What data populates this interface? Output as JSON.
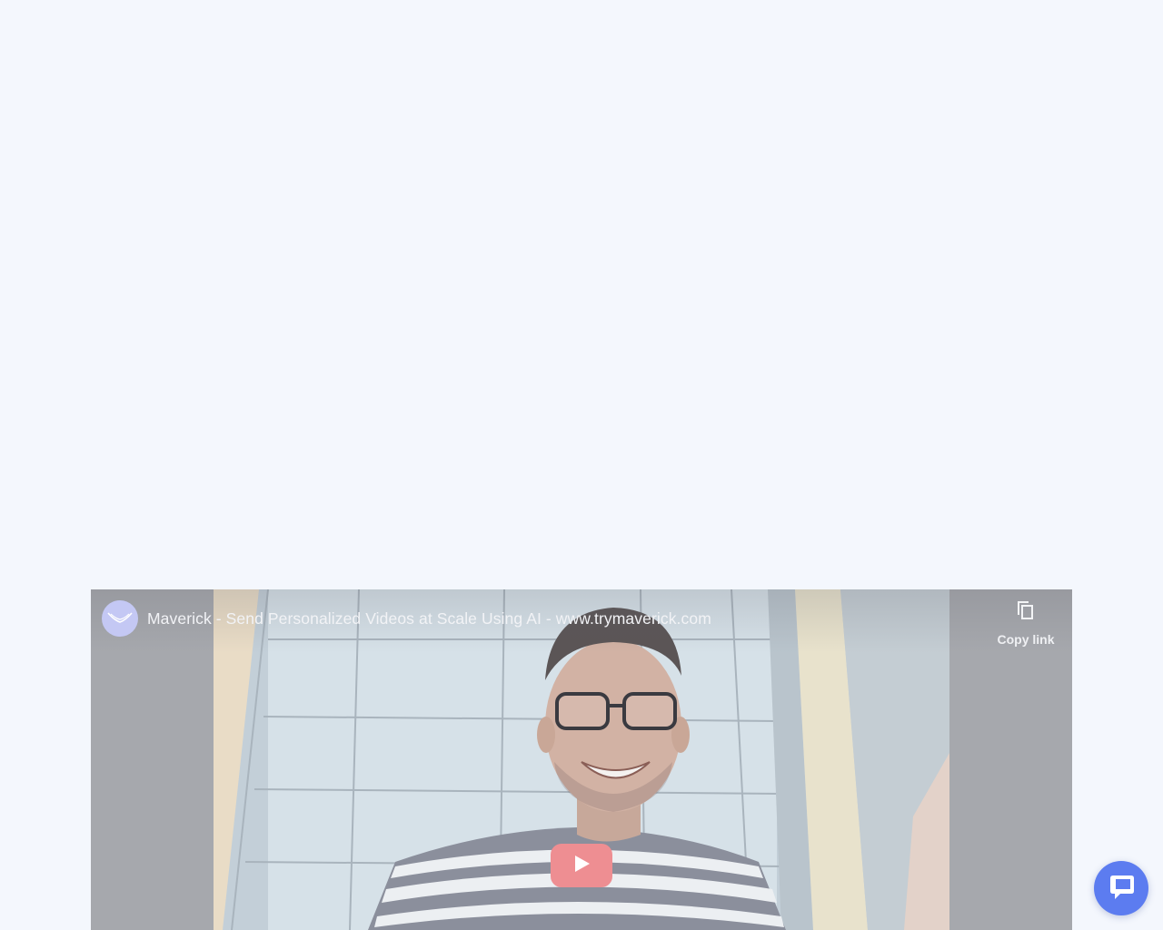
{
  "video": {
    "title": "Maverick - Send Personalized Videos at Scale Using AI - www.trymaverick.com",
    "copy_link_label": "Copy link",
    "avatar_icon": "maverick-logo-icon",
    "copy_icon": "copy-icon",
    "play_icon": "play-icon"
  },
  "chat": {
    "icon": "chat-bubble-icon"
  },
  "colors": {
    "page_background": "#f4f7fd",
    "play_button": "#ee8e92",
    "chat_launcher": "#5c7cf0",
    "avatar_background": "#c4c8f4"
  }
}
